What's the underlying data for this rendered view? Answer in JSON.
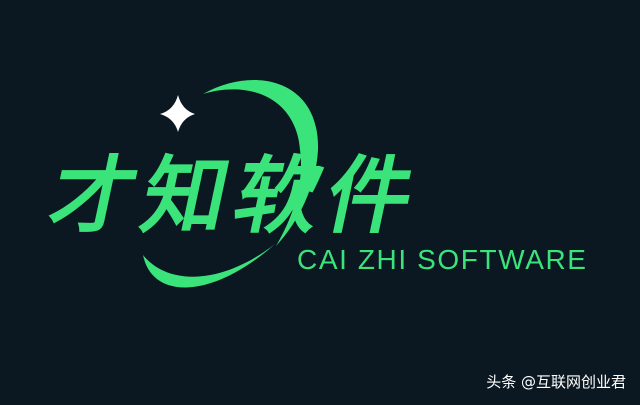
{
  "logo": {
    "title_cn": "才知软件",
    "subtitle_en": "CAI ZHI SOFTWARE",
    "colors": {
      "background": "#0b1822",
      "brand_green": "#3be47b",
      "star": "#ffffff"
    },
    "icons": [
      "sparkle-star-icon",
      "orbit-swoosh"
    ]
  },
  "watermark": {
    "text": "头条 @互联网创业君"
  }
}
